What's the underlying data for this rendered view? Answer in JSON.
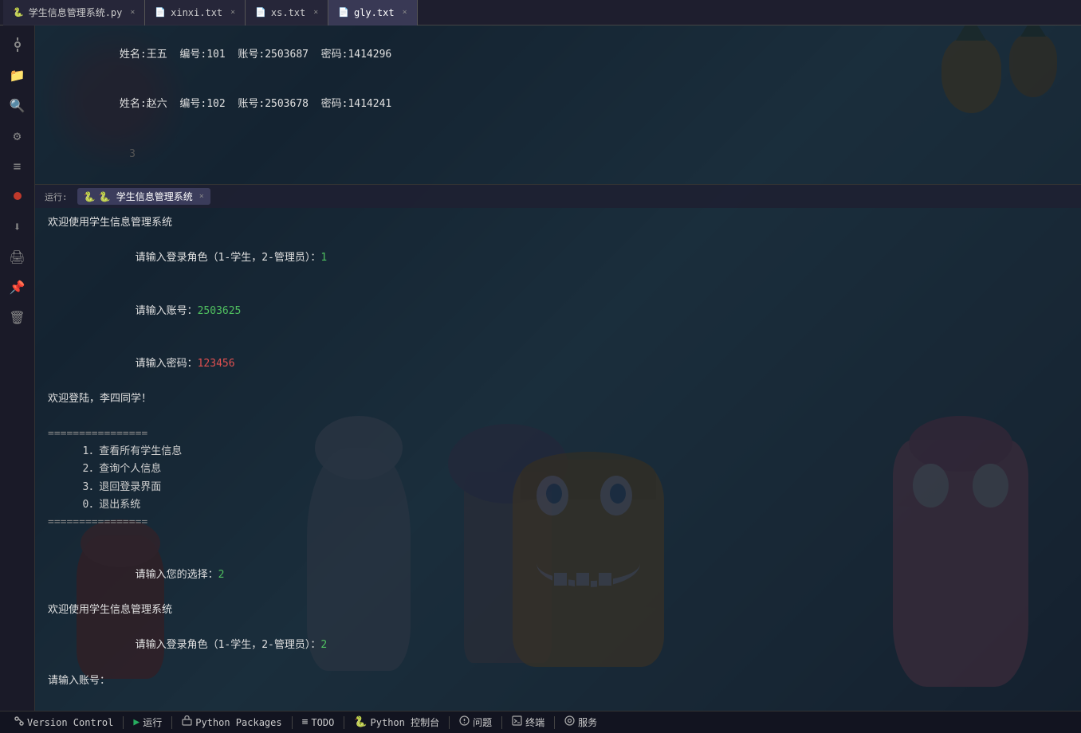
{
  "tabs": [
    {
      "id": "py",
      "label": "学生信息管理系统.py",
      "icon": "🐍",
      "active": false,
      "closable": true
    },
    {
      "id": "xinxi",
      "label": "xinxi.txt",
      "icon": "📄",
      "active": false,
      "closable": true
    },
    {
      "id": "xs",
      "label": "xs.txt",
      "icon": "📄",
      "active": false,
      "closable": true
    },
    {
      "id": "gly",
      "label": "gly.txt",
      "icon": "📄",
      "active": true,
      "closable": true
    }
  ],
  "file_lines": [
    {
      "num": "",
      "text": "姓名:王五  编号:101  账号:2503687  密码:1414296"
    },
    {
      "num": "",
      "text": "姓名:赵六  编号:102  账号:2503678  密码:1414241"
    },
    {
      "num": "3",
      "text": ""
    }
  ],
  "run_tabs": [
    {
      "id": "run",
      "label": "🐍 学生信息管理系统",
      "active": true,
      "closable": true
    }
  ],
  "terminal_lines": [
    {
      "type": "welcome",
      "text": "欢迎使用学生信息管理系统"
    },
    {
      "type": "prompt",
      "text": "请输入登录角色（1-学生，2-管理员）：",
      "input": "1",
      "input_type": "green"
    },
    {
      "type": "prompt",
      "text": "请输入账号：",
      "input": "2503625",
      "input_type": "green"
    },
    {
      "type": "prompt",
      "text": "请输入密码：",
      "input": "123456",
      "input_type": "red"
    },
    {
      "type": "plain",
      "text": "欢迎登陆，李四同学！"
    },
    {
      "type": "plain",
      "text": ""
    },
    {
      "type": "separator",
      "text": "================"
    },
    {
      "type": "menu",
      "text": "   1．查看所有学生信息"
    },
    {
      "type": "menu",
      "text": "   2．查询个人信息"
    },
    {
      "type": "menu",
      "text": "   3．退回登录界面"
    },
    {
      "type": "menu",
      "text": "   0．退出系统"
    },
    {
      "type": "separator",
      "text": "================"
    },
    {
      "type": "plain",
      "text": ""
    },
    {
      "type": "prompt",
      "text": "请输入您的选择：",
      "input": "2",
      "input_type": "green"
    },
    {
      "type": "welcome",
      "text": "欢迎使用学生信息管理系统"
    },
    {
      "type": "prompt",
      "text": "请输入登录角色（1-学生，2-管理员）：",
      "input": "2",
      "input_type": "green"
    },
    {
      "type": "prompt",
      "text": "请输入账号：",
      "input": "",
      "input_type": "green"
    }
  ],
  "status_bar": {
    "version_control": "Version Control",
    "run": "运行",
    "python_packages": "Python Packages",
    "todo": "TODO",
    "python_console": "Python 控制台",
    "problems": "问题",
    "terminal": "终端",
    "services": "服务"
  },
  "sidebar_icons": [
    "⚙",
    "📁",
    "🔍",
    "🔧",
    "≡",
    "⏺",
    "⬇",
    "🖨",
    "📌",
    "🗑"
  ]
}
